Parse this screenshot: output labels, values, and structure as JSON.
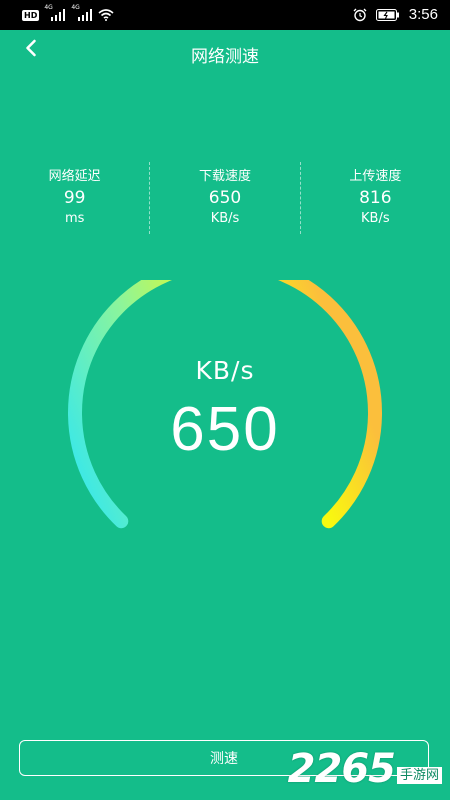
{
  "status_bar": {
    "hd_label": "HD",
    "network_1": "4G",
    "network_2": "4G",
    "time": "3:56"
  },
  "header": {
    "title": "网络测速",
    "back_icon": "chevron-left-icon"
  },
  "stats": [
    {
      "label": "网络延迟",
      "value": "99",
      "unit": "ms"
    },
    {
      "label": "下载速度",
      "value": "650",
      "unit": "KB/s"
    },
    {
      "label": "上传速度",
      "value": "816",
      "unit": "KB/s"
    }
  ],
  "gauge": {
    "unit": "KB/s",
    "value": "650",
    "colors": [
      "#2de6f5",
      "#8df59a",
      "#f9fa0e",
      "#fbbf3c"
    ]
  },
  "actions": {
    "test_label": "测速"
  },
  "watermark": {
    "number": "2265",
    "text": "手游网"
  },
  "theme": {
    "background": "#14bd8a",
    "status_bar": "#000000"
  }
}
